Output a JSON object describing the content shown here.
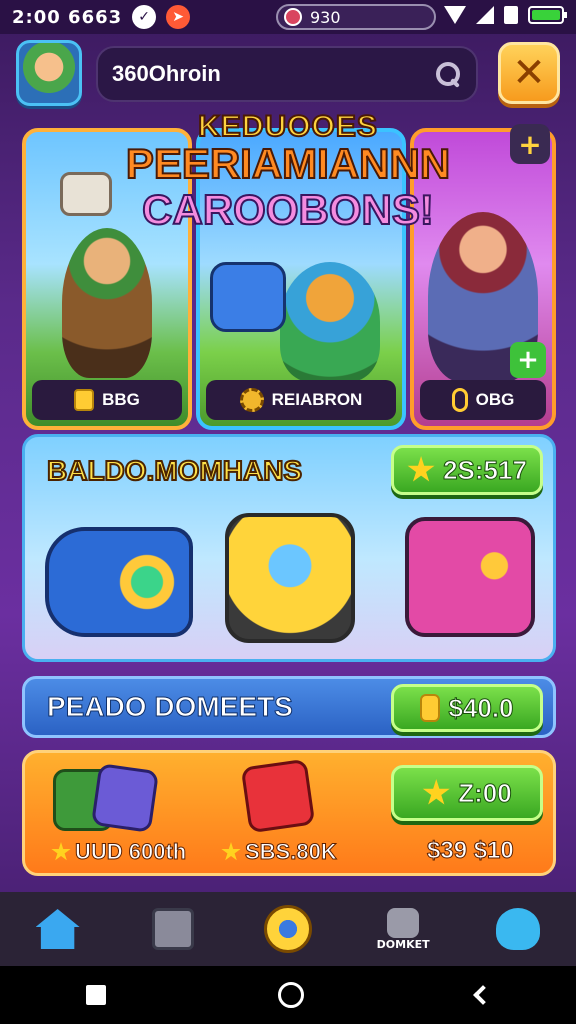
{
  "status_bar": {
    "time": "2:00 6663",
    "pill_text": "930"
  },
  "header": {
    "search_value": "360Ohroin",
    "close_label": "✕"
  },
  "hero": {
    "title_line1": "KEDUOOES",
    "title_line2": "PEERIAMIANNN",
    "title_line3": "CAROOBONS!",
    "cards": [
      {
        "label": "BBG"
      },
      {
        "label": "REIABRON"
      },
      {
        "label": "OBG"
      }
    ]
  },
  "bundle": {
    "title": "BALDO.MOMHANS",
    "price": "2S:517"
  },
  "deals": {
    "title": "PEADO DOMEETS",
    "price": "$40.0"
  },
  "offers": {
    "item1_label": "UUD 600th",
    "item2_label": "SBS.80K",
    "price_button": "Z:00",
    "price_text": "$39 $10"
  },
  "bottom_nav": {
    "item4_label": "DOMKET"
  },
  "colors": {
    "accent_orange": "#ff9d2b",
    "accent_green": "#3aa822",
    "background": "#5a2a8a"
  }
}
